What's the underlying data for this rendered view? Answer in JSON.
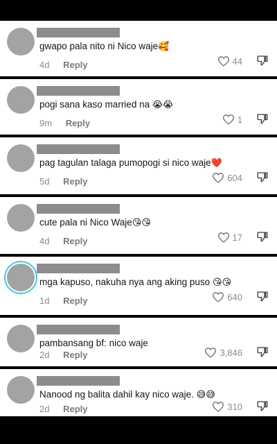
{
  "reply_label": "Reply",
  "colors": {
    "avatar": "#a3a3a3",
    "story_ring": "#3fc8de",
    "meta": "#8a8a8a",
    "text": "#161616"
  },
  "comments": [
    {
      "text": "gwapo pala nito ni Nico waje",
      "emoji": "🥰",
      "time": "4d",
      "likes": "44"
    },
    {
      "text": "pogi sana kaso married na ",
      "emoji": "😭😭",
      "time": "9m",
      "likes": "1"
    },
    {
      "text": "pag tagulan talaga pumopogi si nico waje",
      "emoji": "❤️",
      "time": "5d",
      "likes": "604"
    },
    {
      "text": "cute pala ni Nico Waje",
      "emoji": "😘😘",
      "time": "4d",
      "likes": "17"
    },
    {
      "text": "mga kapuso, nakuha nya ang aking puso ",
      "emoji": "😘😘",
      "time": "1d",
      "likes": "640"
    },
    {
      "text": "pambansang bf: nico waje",
      "emoji": "",
      "time": "2d",
      "likes": "3,846"
    },
    {
      "text": "Nanood ng balita dahil kay nico waje. ",
      "emoji": "😅😅",
      "time": "2d",
      "likes": "310"
    }
  ]
}
